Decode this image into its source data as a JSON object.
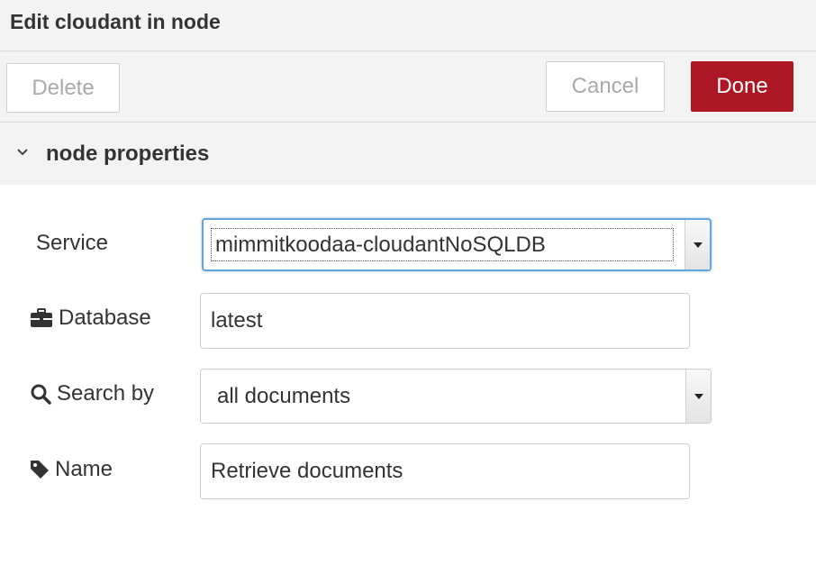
{
  "window": {
    "title": "Edit cloudant in node"
  },
  "toolbar": {
    "delete_label": "Delete",
    "cancel_label": "Cancel",
    "done_label": "Done"
  },
  "section": {
    "title": "node properties"
  },
  "form": {
    "service": {
      "label": "Service",
      "value": "mimmitkoodaa-cloudantNoSQLDB"
    },
    "database": {
      "label": "Database",
      "value": "latest",
      "icon": "briefcase-icon"
    },
    "search_by": {
      "label": "Search by",
      "value": "all documents",
      "icon": "search-icon"
    },
    "name": {
      "label": "Name",
      "value": "Retrieve documents",
      "icon": "tag-icon"
    }
  },
  "colors": {
    "accent": "#ad1625",
    "focus": "#66a4e0",
    "header_bg": "#f3f3f3"
  }
}
